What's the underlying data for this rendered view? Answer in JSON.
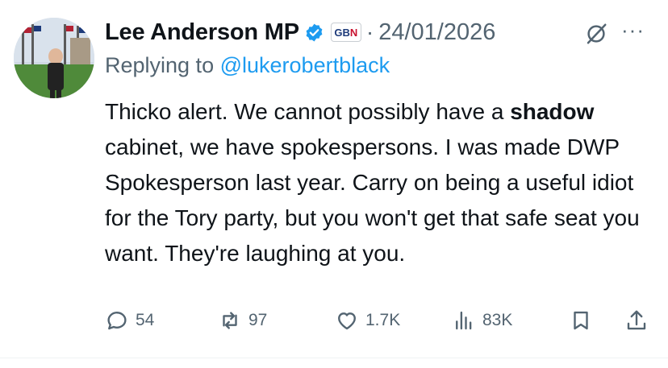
{
  "tweet": {
    "author_name": "Lee Anderson MP",
    "affiliation_badge": {
      "left": "GB",
      "right": "N"
    },
    "separator": "·",
    "date": "24/01/2026",
    "more_label": "···",
    "replying_prefix": "Replying to",
    "replying_handle": "@lukerobertblack",
    "text_before_bold": "Thicko alert. We cannot possibly have a ",
    "text_bold": "shadow",
    "text_after_bold": " cabinet, we have spokespersons. I was made DWP Spokesperson last year. Carry on being a useful idiot for the Tory party, but you won't get that safe seat you want. They're laughing at you."
  },
  "actions": {
    "replies": "54",
    "reposts": "97",
    "likes": "1.7K",
    "views": "83K"
  },
  "colors": {
    "text": "#0f1419",
    "secondary": "#536471",
    "link": "#1d9bf0",
    "verified": "#1d9bf0"
  }
}
